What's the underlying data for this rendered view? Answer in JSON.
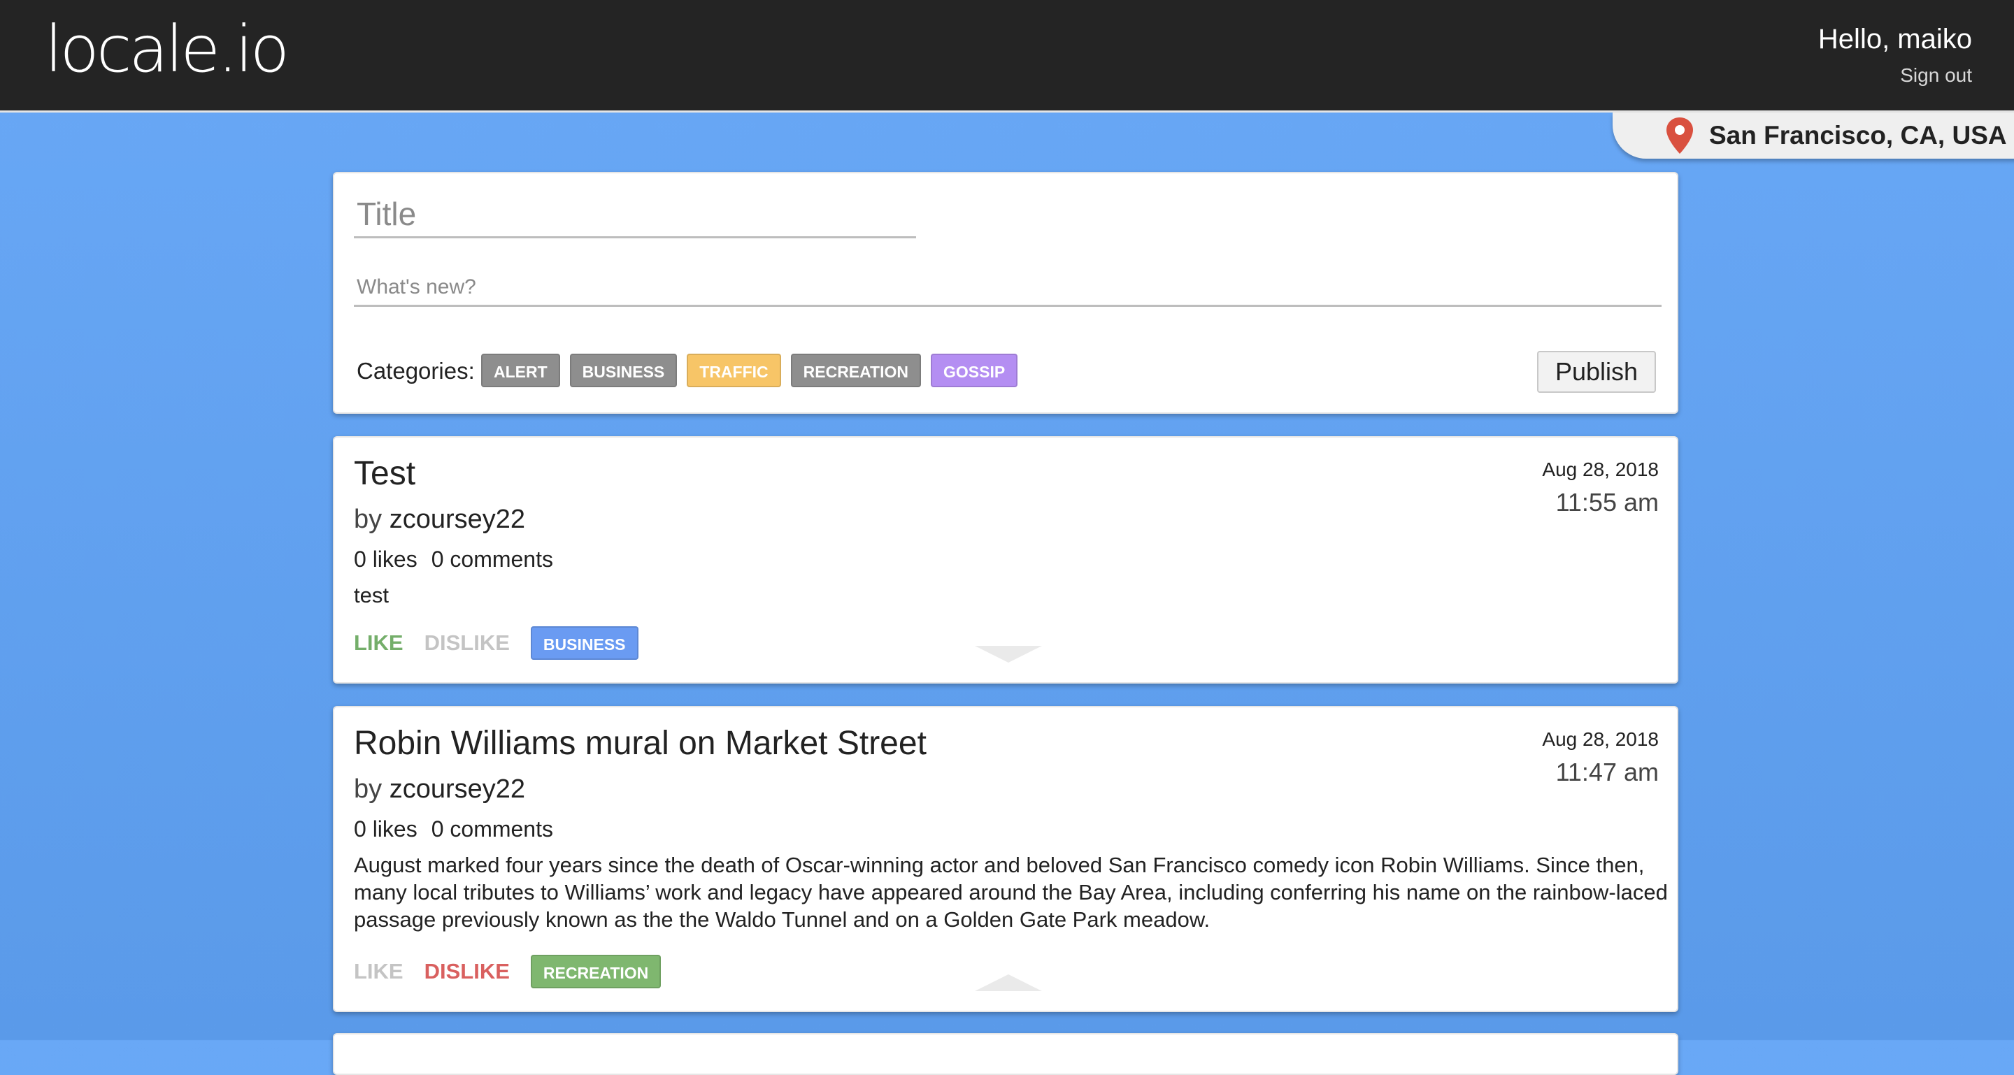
{
  "app": {
    "logo": "locale.io"
  },
  "header": {
    "greeting": "Hello, maiko",
    "signout": "Sign out"
  },
  "location": {
    "label": "San Francisco, CA, USA",
    "pin_color": "#d9503f"
  },
  "composer": {
    "title_placeholder": "Title",
    "body_placeholder": "What's new?",
    "categories_label": "Categories:",
    "categories": [
      {
        "label": "ALERT",
        "color": "#8e8e8e"
      },
      {
        "label": "BUSINESS",
        "color": "#8e8e8e"
      },
      {
        "label": "TRAFFIC",
        "color": "#f7c567"
      },
      {
        "label": "RECREATION",
        "color": "#8e8e8e"
      },
      {
        "label": "GOSSIP",
        "color": "#b48ef2"
      }
    ],
    "publish_label": "Publish"
  },
  "posts": [
    {
      "title": "Test",
      "by": "by",
      "author": "zcoursey22",
      "likes": "0 likes",
      "comments": "0 comments",
      "body": "test",
      "date": "Aug 28, 2018",
      "time": "11:55 am",
      "like_label": "LIKE",
      "dislike_label": "DISLIKE",
      "vote": "like",
      "category": {
        "label": "BUSINESS",
        "color": "#6a9bf2"
      },
      "toggle_icon": "caret-down-icon"
    },
    {
      "title": "Robin Williams mural on Market Street",
      "by": "by",
      "author": "zcoursey22",
      "likes": "0 likes",
      "comments": "0 comments",
      "body": "August marked four years since the death of Oscar-winning actor and beloved San Francisco comedy icon Robin Williams. Since then, many local tributes to Williams’ work and legacy have appeared around the Bay Area, including conferring his name on the rainbow-laced passage previously known as the the Waldo Tunnel and on a Golden Gate Park meadow.",
      "date": "Aug 28, 2018",
      "time": "11:47 am",
      "like_label": "LIKE",
      "dislike_label": "DISLIKE",
      "vote": "dislike",
      "category": {
        "label": "RECREATION",
        "color": "#7fb76f"
      },
      "toggle_icon": "caret-up-icon"
    }
  ]
}
